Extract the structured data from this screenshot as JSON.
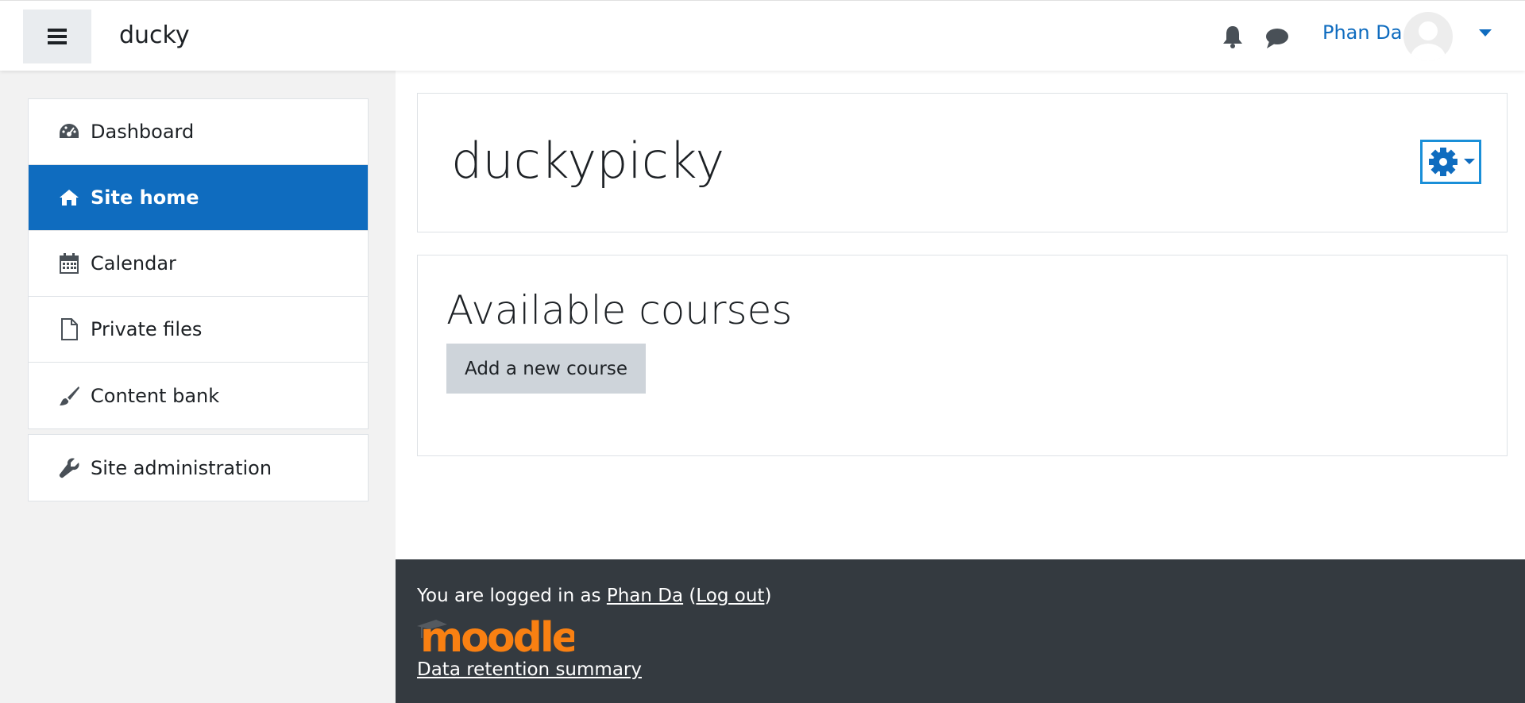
{
  "navbar": {
    "site_name": "ducky",
    "user_name": "Phan Da"
  },
  "drawer": {
    "items": [
      {
        "label": "Dashboard",
        "icon": "dashboard-icon"
      },
      {
        "label": "Site home",
        "icon": "home-icon",
        "active": true
      },
      {
        "label": "Calendar",
        "icon": "calendar-icon"
      },
      {
        "label": "Private files",
        "icon": "file-icon"
      },
      {
        "label": "Content bank",
        "icon": "paintbrush-icon"
      }
    ],
    "admin_item": {
      "label": "Site administration",
      "icon": "wrench-icon"
    }
  },
  "main": {
    "page_title": "duckypicky",
    "section_title": "Available courses",
    "add_course_label": "Add a new course"
  },
  "footer": {
    "logged_in_prefix": "You are logged in as ",
    "user_link": "Phan Da",
    "open_paren": " (",
    "logout_link": "Log out",
    "close_paren": ")",
    "logo_text": "moodle",
    "retention_link": "Data retention summary"
  },
  "colors": {
    "accent": "#0f6cbf",
    "footer_bg": "#343a40",
    "moodle_orange": "#f98012"
  }
}
